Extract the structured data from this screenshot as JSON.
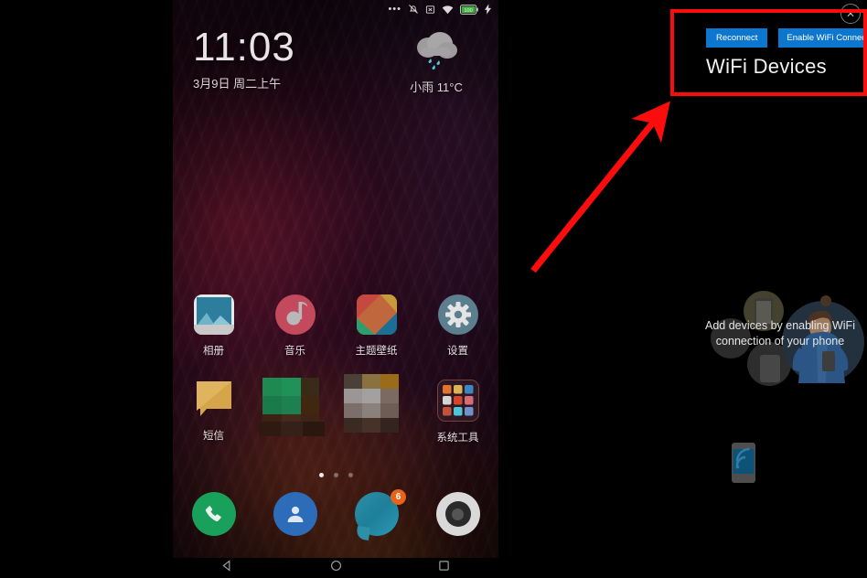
{
  "phone": {
    "statusbar": {
      "icons": [
        "more-dots-icon",
        "bell-off-icon",
        "no-sim-icon",
        "wifi-icon",
        "battery-icon",
        "charging-bolt-icon"
      ],
      "battery_level": "100"
    },
    "clock": {
      "time": "11:03",
      "date": "3月9日 周二上午"
    },
    "weather": {
      "icon": "rain-cloud-icon",
      "text": "小雨  11°C",
      "condition": "小雨",
      "temperature": "11°C"
    },
    "apps_row1": [
      {
        "label": "相册",
        "icon": "gallery-icon"
      },
      {
        "label": "音乐",
        "icon": "music-icon"
      },
      {
        "label": "主题壁纸",
        "icon": "themes-icon"
      },
      {
        "label": "设置",
        "icon": "settings-gear-icon"
      }
    ],
    "apps_row2": [
      {
        "label": "短信",
        "icon": "sms-icon"
      },
      {
        "label": "",
        "icon": "censored-app-icon"
      },
      {
        "label": "",
        "icon": "censored-app-icon"
      },
      {
        "label": "系统工具",
        "icon": "system-tools-folder-icon"
      }
    ],
    "page_dots": {
      "count": 3,
      "active": 1
    },
    "dock": [
      {
        "label": "phone",
        "icon": "phone-handset-icon",
        "badge": ""
      },
      {
        "label": "contacts",
        "icon": "contacts-person-icon",
        "badge": ""
      },
      {
        "label": "messages",
        "icon": "messages-bubble-icon",
        "badge": "6"
      },
      {
        "label": "camera",
        "icon": "camera-lens-icon",
        "badge": ""
      }
    ],
    "navbar": [
      {
        "name": "back",
        "icon": "back-triangle-icon"
      },
      {
        "name": "home",
        "icon": "home-circle-icon"
      },
      {
        "name": "recents",
        "icon": "recents-square-icon"
      }
    ]
  },
  "panel": {
    "close_label": "✕",
    "buttons": {
      "reconnect": "Reconnect",
      "enable_wifi": "Enable WiFi Connection"
    },
    "title": "WiFi Devices",
    "hint": "Add devices by enabling WiFi connection of your phone",
    "illustration_icon": "person-with-phone-illustration",
    "phone_wifi_icon": "phone-wifi-icon"
  },
  "annotations": {
    "highlight_color": "#fb0d0d",
    "arrow_color": "#fb0d0d",
    "box_target": "wifi-devices-panel-header",
    "arrow_from": "583,295",
    "arrow_to": "727,125"
  },
  "colors": {
    "button_blue": "#0d76cf",
    "badge_orange": "#e8631a",
    "annotation_red": "#fb0d0d",
    "panel_background": "#000000"
  }
}
